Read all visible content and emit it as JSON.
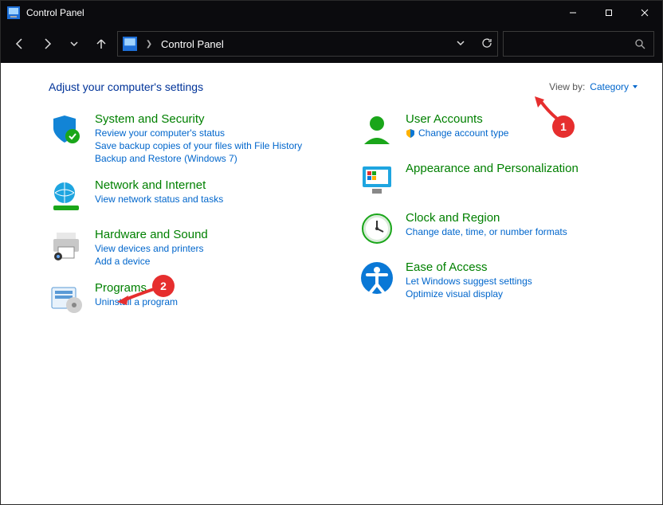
{
  "window": {
    "title": "Control Panel"
  },
  "address": {
    "location": "Control Panel"
  },
  "page": {
    "heading": "Adjust your computer's settings",
    "viewby_label": "View by:",
    "viewby_value": "Category"
  },
  "left": [
    {
      "title": "System and Security",
      "links": [
        "Review your computer's status",
        "Save backup copies of your files with File History",
        "Backup and Restore (Windows 7)"
      ]
    },
    {
      "title": "Network and Internet",
      "links": [
        "View network status and tasks"
      ]
    },
    {
      "title": "Hardware and Sound",
      "links": [
        "View devices and printers",
        "Add a device"
      ]
    },
    {
      "title": "Programs",
      "links": [
        "Uninstall a program"
      ]
    }
  ],
  "right": [
    {
      "title": "User Accounts",
      "links": [
        "Change account type"
      ],
      "shield": true
    },
    {
      "title": "Appearance and Personalization",
      "links": []
    },
    {
      "title": "Clock and Region",
      "links": [
        "Change date, time, or number formats"
      ]
    },
    {
      "title": "Ease of Access",
      "links": [
        "Let Windows suggest settings",
        "Optimize visual display"
      ]
    }
  ],
  "annotations": {
    "badge1": "1",
    "badge2": "2"
  }
}
